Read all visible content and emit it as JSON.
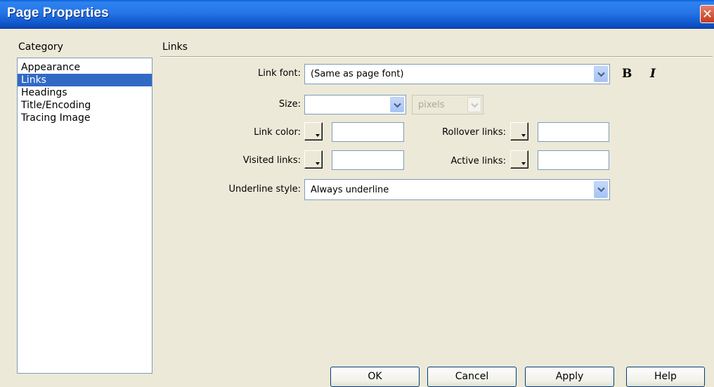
{
  "window": {
    "title": "Page Properties",
    "close_glyph": "✕"
  },
  "sidebar": {
    "heading": "Category",
    "items": [
      "Appearance",
      "Links",
      "Headings",
      "Title/Encoding",
      "Tracing Image"
    ],
    "selected": "Links"
  },
  "section": {
    "title": "Links"
  },
  "fields": {
    "link_font": {
      "label": "Link font:",
      "value": "(Same as page font)"
    },
    "size": {
      "label": "Size:",
      "value": "",
      "unit": "pixels"
    },
    "bold_label": "B",
    "italic_label": "I",
    "link_color": {
      "label": "Link color:",
      "value": ""
    },
    "rollover_links": {
      "label": "Rollover links:",
      "value": ""
    },
    "visited_links": {
      "label": "Visited links:",
      "value": ""
    },
    "active_links": {
      "label": "Active links:",
      "value": ""
    },
    "underline_style": {
      "label": "Underline style:",
      "value": "Always underline"
    }
  },
  "buttons": {
    "ok": "OK",
    "cancel": "Cancel",
    "apply": "Apply",
    "help": "Help"
  },
  "colors": {
    "titlebar": "#2575e6",
    "dialog_bg": "#ece9d8",
    "selection": "#316ac5"
  }
}
